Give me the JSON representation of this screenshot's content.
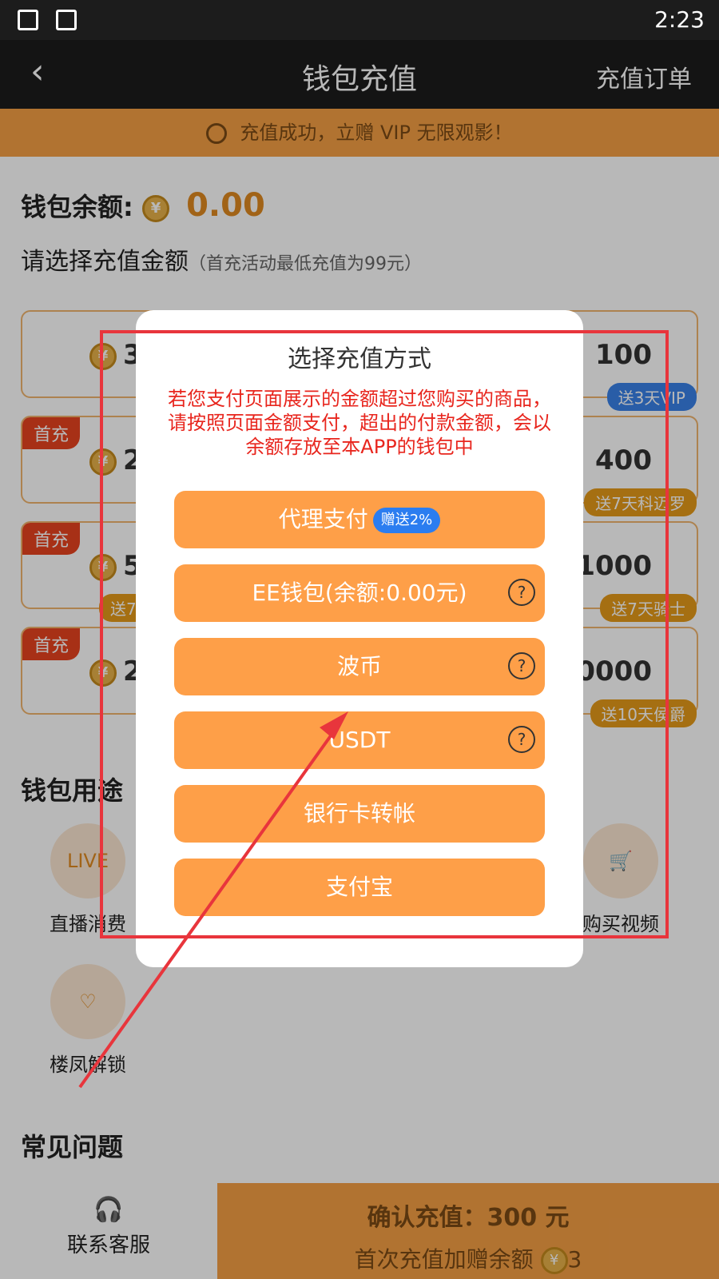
{
  "status_bar": {
    "time": "2:23"
  },
  "header": {
    "back_icon": "chevron-left-icon",
    "title": "钱包充值",
    "orders": "充值订单"
  },
  "banner": {
    "text": "充值成功，立赠 VIP 无限观影！"
  },
  "balance": {
    "label": "钱包余额:",
    "amount": "0.00"
  },
  "recharge": {
    "title": "请选择充值金额",
    "note": "（首充活动最低充值为99元）"
  },
  "cards": [
    {
      "value": "3",
      "tag": "",
      "gift": ""
    },
    {
      "value": "",
      "tag": "",
      "gift": ""
    },
    {
      "value": "100",
      "tag": "",
      "gift": "送3天VIP"
    },
    {
      "value": "2",
      "tag": "首充",
      "gift": ""
    },
    {
      "value": "",
      "tag": "",
      "gift": ""
    },
    {
      "value": "400",
      "tag": "",
      "gift": "送7天科迈罗"
    },
    {
      "value": "5",
      "tag": "首充",
      "gift": "送7"
    },
    {
      "value": "",
      "tag": "",
      "gift": ""
    },
    {
      "value": "1000",
      "tag": "",
      "gift": "送7天骑士"
    },
    {
      "value": "20",
      "tag": "首充",
      "gift": ""
    },
    {
      "value": "",
      "tag": "",
      "gift": ""
    },
    {
      "value": "10000",
      "tag": "",
      "gift": "送10天侯爵"
    }
  ],
  "usage": {
    "title": "钱包用途",
    "items": [
      {
        "label": "直播消费",
        "icon": "live-tv-icon",
        "icon_text": "LIVE"
      },
      {
        "label": "购买视频",
        "icon": "cart-icon",
        "icon_text": "🛒"
      },
      {
        "label": "楼凤解锁",
        "icon": "lingerie-icon",
        "icon_text": "♡"
      }
    ]
  },
  "faq": {
    "title": "常见问题"
  },
  "bottom": {
    "support": "联系客服",
    "confirm_line1": "确认充值：300 元",
    "confirm_line2": "首次充值加赠余额",
    "confirm_bonus": "3"
  },
  "modal": {
    "title": "选择充值方式",
    "warning": "若您支付页面展示的金额超过您购买的商品，请按照页面金额支付，超出的付款金额，会以余额存放至本APP的钱包中",
    "options": [
      {
        "label": "代理支付",
        "badge": "赠送2%",
        "help": false
      },
      {
        "label": "EE钱包(余额:0.00元)",
        "badge": "",
        "help": true
      },
      {
        "label": "波币",
        "badge": "",
        "help": true
      },
      {
        "label": "USDT",
        "badge": "",
        "help": true
      },
      {
        "label": "银行卡转帐",
        "badge": "",
        "help": false
      },
      {
        "label": "支付宝",
        "badge": "",
        "help": false
      }
    ]
  },
  "colors": {
    "accent": "#fe9f48",
    "warn": "#e8261e",
    "annotation": "#e8353c"
  }
}
